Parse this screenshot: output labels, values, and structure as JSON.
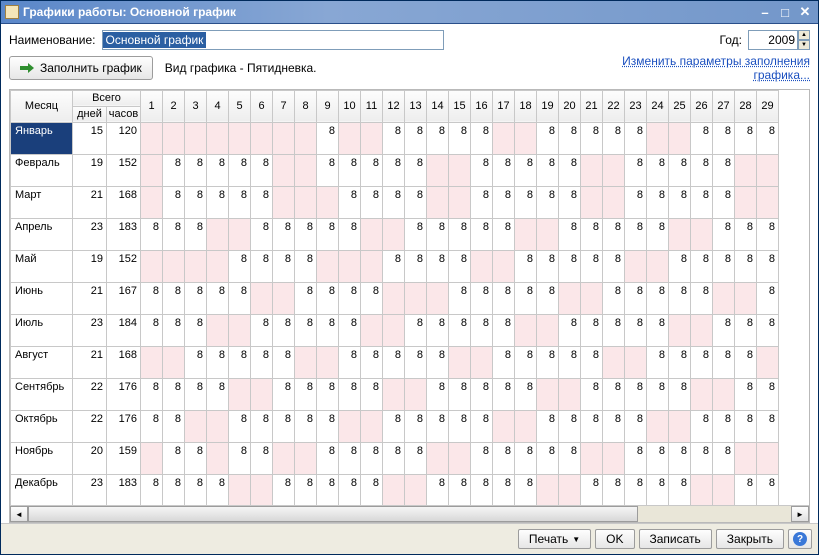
{
  "window": {
    "title": "Графики работы: Основной график"
  },
  "row1": {
    "name_label": "Наименование:",
    "name_value": "Основной график",
    "year_label": "Год:",
    "year_value": "2009"
  },
  "row2": {
    "fill_button": "Заполнить график",
    "info": "Вид графика - Пятидневка.",
    "link": "Изменить параметры заполнения графика..."
  },
  "table": {
    "headers": {
      "month": "Месяц",
      "total": "Всего",
      "days": "дней",
      "hours": "часов"
    },
    "day_numbers": [
      1,
      2,
      3,
      4,
      5,
      6,
      7,
      8,
      9,
      10,
      11,
      12,
      13,
      14,
      15,
      16,
      17,
      18,
      19,
      20,
      21,
      22,
      23,
      24,
      25,
      26,
      27,
      28,
      29
    ],
    "rows": [
      {
        "month": "Январь",
        "days": 15,
        "hours": 120,
        "cells": [
          "",
          "",
          "",
          "",
          "",
          "",
          "",
          "",
          "8",
          "",
          "",
          "8",
          "8",
          "8",
          "8",
          "8",
          "",
          "",
          "8",
          "8",
          "8",
          "8",
          "8",
          "",
          "",
          "8",
          "8",
          "8",
          "8"
        ]
      },
      {
        "month": "Февраль",
        "days": 19,
        "hours": 152,
        "cells": [
          "",
          "8",
          "8",
          "8",
          "8",
          "8",
          "",
          "",
          "8",
          "8",
          "8",
          "8",
          "8",
          "",
          "",
          "8",
          "8",
          "8",
          "8",
          "8",
          "",
          "",
          "8",
          "8",
          "8",
          "8",
          "8",
          "",
          ""
        ]
      },
      {
        "month": "Март",
        "days": 21,
        "hours": 168,
        "cells": [
          "",
          "8",
          "8",
          "8",
          "8",
          "8",
          "",
          "",
          "",
          "8",
          "8",
          "8",
          "8",
          "",
          "",
          "8",
          "8",
          "8",
          "8",
          "8",
          "",
          "",
          "8",
          "8",
          "8",
          "8",
          "8",
          "",
          ""
        ]
      },
      {
        "month": "Апрель",
        "days": 23,
        "hours": 183,
        "cells": [
          "8",
          "8",
          "8",
          "",
          "",
          "8",
          "8",
          "8",
          "8",
          "8",
          "",
          "",
          "8",
          "8",
          "8",
          "8",
          "8",
          "",
          "",
          "8",
          "8",
          "8",
          "8",
          "8",
          "",
          "",
          "8",
          "8",
          "8"
        ]
      },
      {
        "month": "Май",
        "days": 19,
        "hours": 152,
        "cells": [
          "",
          "",
          "",
          "",
          "8",
          "8",
          "8",
          "8",
          "",
          "",
          "",
          "8",
          "8",
          "8",
          "8",
          "",
          "",
          "8",
          "8",
          "8",
          "8",
          "8",
          "",
          "",
          "8",
          "8",
          "8",
          "8",
          "8"
        ]
      },
      {
        "month": "Июнь",
        "days": 21,
        "hours": 167,
        "cells": [
          "8",
          "8",
          "8",
          "8",
          "8",
          "",
          "",
          "8",
          "8",
          "8",
          "8",
          "",
          "",
          "",
          "8",
          "8",
          "8",
          "8",
          "8",
          "",
          "",
          "8",
          "8",
          "8",
          "8",
          "8",
          "",
          "",
          "8"
        ]
      },
      {
        "month": "Июль",
        "days": 23,
        "hours": 184,
        "cells": [
          "8",
          "8",
          "8",
          "",
          "",
          "8",
          "8",
          "8",
          "8",
          "8",
          "",
          "",
          "8",
          "8",
          "8",
          "8",
          "8",
          "",
          "",
          "8",
          "8",
          "8",
          "8",
          "8",
          "",
          "",
          "8",
          "8",
          "8"
        ]
      },
      {
        "month": "Август",
        "days": 21,
        "hours": 168,
        "cells": [
          "",
          "",
          "8",
          "8",
          "8",
          "8",
          "8",
          "",
          "",
          "8",
          "8",
          "8",
          "8",
          "8",
          "",
          "",
          "8",
          "8",
          "8",
          "8",
          "8",
          "",
          "",
          "8",
          "8",
          "8",
          "8",
          "8",
          ""
        ]
      },
      {
        "month": "Сентябрь",
        "days": 22,
        "hours": 176,
        "cells": [
          "8",
          "8",
          "8",
          "8",
          "",
          "",
          "8",
          "8",
          "8",
          "8",
          "8",
          "",
          "",
          "8",
          "8",
          "8",
          "8",
          "8",
          "",
          "",
          "8",
          "8",
          "8",
          "8",
          "8",
          "",
          "",
          "8",
          "8"
        ]
      },
      {
        "month": "Октябрь",
        "days": 22,
        "hours": 176,
        "cells": [
          "8",
          "8",
          "",
          "",
          "8",
          "8",
          "8",
          "8",
          "8",
          "",
          "",
          "8",
          "8",
          "8",
          "8",
          "8",
          "",
          "",
          "8",
          "8",
          "8",
          "8",
          "8",
          "",
          "",
          "8",
          "8",
          "8",
          "8"
        ]
      },
      {
        "month": "Ноябрь",
        "days": 20,
        "hours": 159,
        "cells": [
          "",
          "8",
          "8",
          "",
          "8",
          "8",
          "",
          "",
          "8",
          "8",
          "8",
          "8",
          "8",
          "",
          "",
          "8",
          "8",
          "8",
          "8",
          "8",
          "",
          "",
          "8",
          "8",
          "8",
          "8",
          "8",
          "",
          ""
        ]
      },
      {
        "month": "Декабрь",
        "days": 23,
        "hours": 183,
        "cells": [
          "8",
          "8",
          "8",
          "8",
          "",
          "",
          "8",
          "8",
          "8",
          "8",
          "8",
          "",
          "",
          "8",
          "8",
          "8",
          "8",
          "8",
          "",
          "",
          "8",
          "8",
          "8",
          "8",
          "8",
          "",
          "",
          "8",
          "8"
        ]
      }
    ]
  },
  "footer": {
    "print": "Печать",
    "ok": "OK",
    "save": "Записать",
    "close": "Закрыть"
  }
}
